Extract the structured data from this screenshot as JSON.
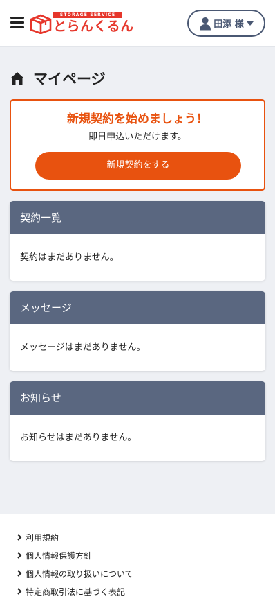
{
  "header": {
    "logo_subtitle": "STORAGE SERVICE",
    "logo_name": "とらんくるん",
    "user_name": "田添 様"
  },
  "page": {
    "title": "マイページ"
  },
  "promo": {
    "heading": "新規契約を始めましょう！",
    "subtext": "即日申込いただけます。",
    "button_label": "新規契約をする"
  },
  "cards": [
    {
      "title": "契約一覧",
      "empty_text": "契約はまだありません。"
    },
    {
      "title": "メッセージ",
      "empty_text": "メッセージはまだありません。"
    },
    {
      "title": "お知らせ",
      "empty_text": "お知らせはまだありません。"
    }
  ],
  "footer": {
    "links": [
      {
        "label": "利用規約"
      },
      {
        "label": "個人情報保護方針"
      },
      {
        "label": "個人情報の取り扱いについて"
      },
      {
        "label": "特定商取引法に基づく表記"
      }
    ]
  },
  "icons": {
    "menu": "hamburger-icon",
    "logo": "box-logo-icon",
    "user": "user-icon",
    "caret": "caret-down-icon",
    "home": "home-icon",
    "chevron": "chevron-right-icon"
  },
  "colors": {
    "accent": "#e8520f",
    "logo_red": "#e6362b",
    "card_header": "#5a6780",
    "user_button": "#4a5873",
    "background": "#eef0f4"
  }
}
